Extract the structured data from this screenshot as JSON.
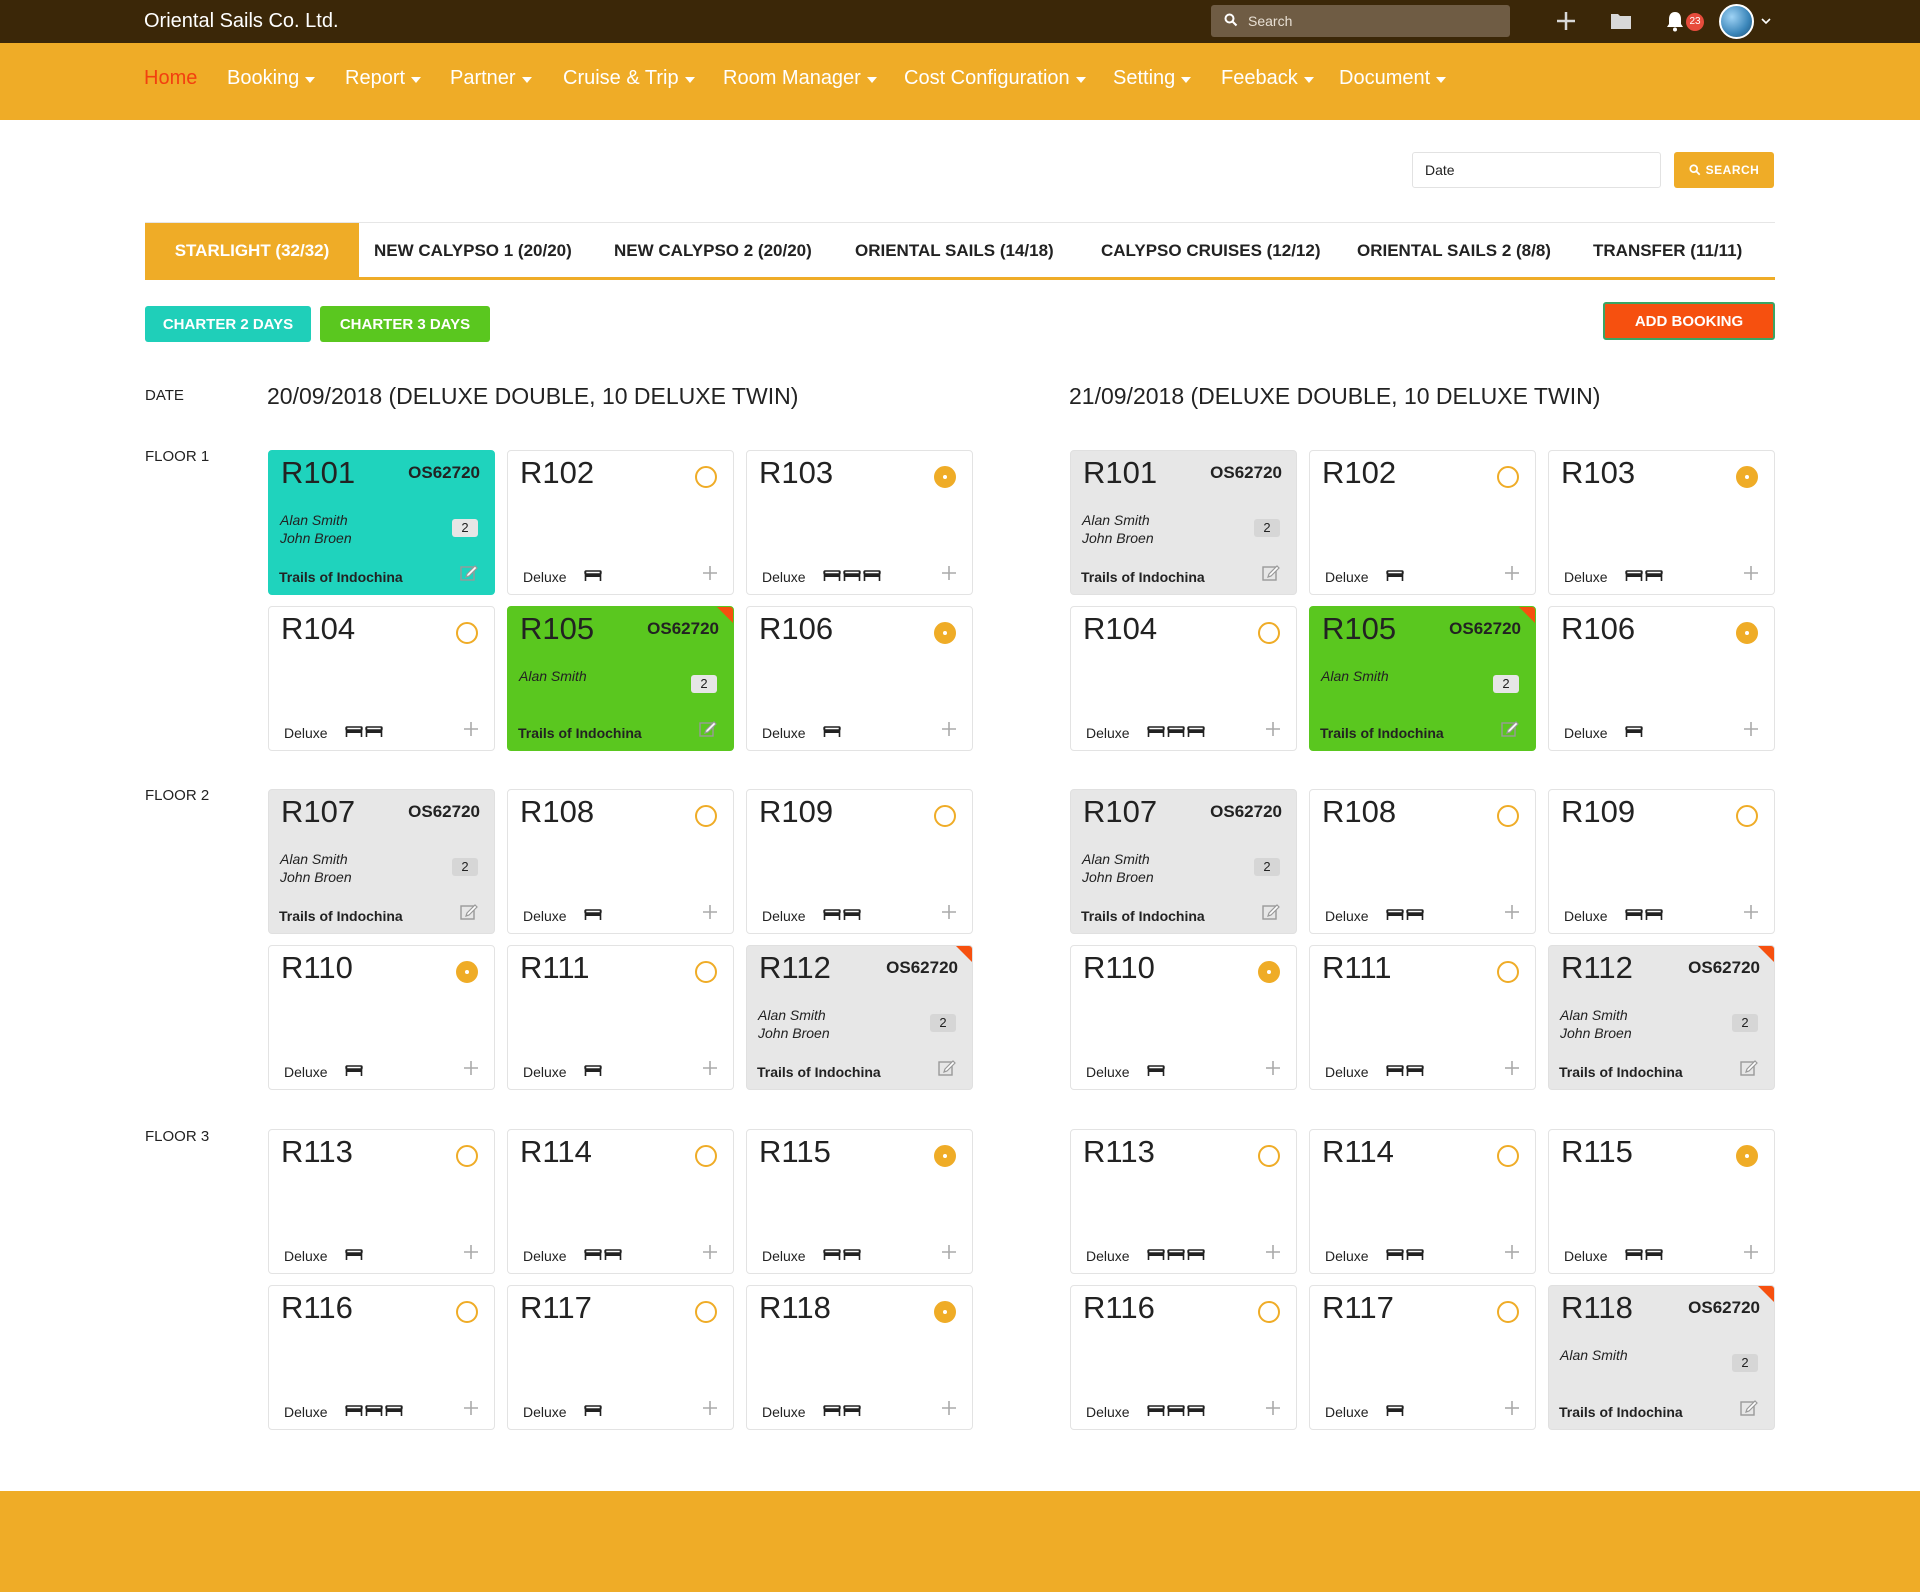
{
  "app": {
    "brand": "Oriental Sails Co. Ltd."
  },
  "topbar": {
    "search_placeholder": "Search",
    "notification_count": "23"
  },
  "nav": {
    "items": [
      {
        "label": "Home"
      },
      {
        "label": "Booking"
      },
      {
        "label": "Report"
      },
      {
        "label": "Partner"
      },
      {
        "label": "Cruise & Trip"
      },
      {
        "label": "Room Manager"
      },
      {
        "label": "Cost Configuration"
      },
      {
        "label": "Setting"
      },
      {
        "label": "Feeback"
      },
      {
        "label": "Document"
      }
    ]
  },
  "filter": {
    "date_placeholder": "Date",
    "search_label": "SEARCH"
  },
  "tabs": [
    {
      "label": "STARLIGHT (32/32)"
    },
    {
      "label": "NEW CALYPSO 1 (20/20)"
    },
    {
      "label": "NEW CALYPSO 2 (20/20)"
    },
    {
      "label": "ORIENTAL SAILS (14/18)"
    },
    {
      "label": "CALYPSO CRUISES (12/12)"
    },
    {
      "label": "ORIENTAL SAILS 2 (8/8)"
    },
    {
      "label": "TRANSFER (11/11)"
    }
  ],
  "buttons": {
    "charter2": "CHARTER 2 DAYS",
    "charter3": "CHARTER 3 DAYS",
    "add_booking": "ADD BOOKING"
  },
  "labels": {
    "date": "DATE",
    "floor1": "FLOOR 1",
    "floor2": "FLOOR 2",
    "floor3": "FLOOR 3"
  },
  "days": [
    {
      "heading": "20/09/2018 (DELUXE DOUBLE, 10 DELUXE TWIN)",
      "rooms": [
        {
          "num": "R101",
          "booked": true,
          "color": "teal",
          "code": "OS62720",
          "guests": [
            "Alan Smith",
            "John Broen"
          ],
          "pax": "2",
          "trip": "Trails of Indochina",
          "flag": false
        },
        {
          "num": "R102",
          "booked": false,
          "selected": false,
          "type": "Deluxe",
          "beds": 1
        },
        {
          "num": "R103",
          "booked": false,
          "selected": true,
          "type": "Deluxe",
          "beds": 3
        },
        {
          "num": "R104",
          "booked": false,
          "selected": false,
          "type": "Deluxe",
          "beds": 2
        },
        {
          "num": "R105",
          "booked": true,
          "color": "green",
          "code": "OS62720",
          "guests": [
            "Alan Smith"
          ],
          "pax": "2",
          "trip": "Trails of Indochina",
          "flag": true
        },
        {
          "num": "R106",
          "booked": false,
          "selected": true,
          "type": "Deluxe",
          "beds": 1
        },
        {
          "num": "R107",
          "booked": true,
          "color": "grey",
          "code": "OS62720",
          "guests": [
            "Alan Smith",
            "John Broen"
          ],
          "pax": "2",
          "trip": "Trails of Indochina",
          "flag": false
        },
        {
          "num": "R108",
          "booked": false,
          "selected": false,
          "type": "Deluxe",
          "beds": 1
        },
        {
          "num": "R109",
          "booked": false,
          "selected": false,
          "type": "Deluxe",
          "beds": 2
        },
        {
          "num": "R110",
          "booked": false,
          "selected": true,
          "type": "Deluxe",
          "beds": 1
        },
        {
          "num": "R111",
          "booked": false,
          "selected": false,
          "type": "Deluxe",
          "beds": 1
        },
        {
          "num": "R112",
          "booked": true,
          "color": "grey",
          "code": "OS62720",
          "guests": [
            "Alan Smith",
            "John Broen"
          ],
          "pax": "2",
          "trip": "Trails of Indochina",
          "flag": true
        },
        {
          "num": "R113",
          "booked": false,
          "selected": false,
          "type": "Deluxe",
          "beds": 1
        },
        {
          "num": "R114",
          "booked": false,
          "selected": false,
          "type": "Deluxe",
          "beds": 2
        },
        {
          "num": "R115",
          "booked": false,
          "selected": true,
          "type": "Deluxe",
          "beds": 2
        },
        {
          "num": "R116",
          "booked": false,
          "selected": false,
          "type": "Deluxe",
          "beds": 3
        },
        {
          "num": "R117",
          "booked": false,
          "selected": false,
          "type": "Deluxe",
          "beds": 1
        },
        {
          "num": "R118",
          "booked": false,
          "selected": true,
          "type": "Deluxe",
          "beds": 2
        }
      ]
    },
    {
      "heading": "21/09/2018 (DELUXE DOUBLE, 10 DELUXE TWIN)",
      "rooms": [
        {
          "num": "R101",
          "booked": true,
          "color": "grey",
          "code": "OS62720",
          "guests": [
            "Alan Smith",
            "John Broen"
          ],
          "pax": "2",
          "trip": "Trails of Indochina",
          "flag": false
        },
        {
          "num": "R102",
          "booked": false,
          "selected": false,
          "type": "Deluxe",
          "beds": 1
        },
        {
          "num": "R103",
          "booked": false,
          "selected": true,
          "type": "Deluxe",
          "beds": 2
        },
        {
          "num": "R104",
          "booked": false,
          "selected": false,
          "type": "Deluxe",
          "beds": 3
        },
        {
          "num": "R105",
          "booked": true,
          "color": "green",
          "code": "OS62720",
          "guests": [
            "Alan Smith"
          ],
          "pax": "2",
          "trip": "Trails of Indochina",
          "flag": true
        },
        {
          "num": "R106",
          "booked": false,
          "selected": true,
          "type": "Deluxe",
          "beds": 1
        },
        {
          "num": "R107",
          "booked": true,
          "color": "grey",
          "code": "OS62720",
          "guests": [
            "Alan Smith",
            "John Broen"
          ],
          "pax": "2",
          "trip": "Trails of Indochina",
          "flag": false
        },
        {
          "num": "R108",
          "booked": false,
          "selected": false,
          "type": "Deluxe",
          "beds": 2
        },
        {
          "num": "R109",
          "booked": false,
          "selected": false,
          "type": "Deluxe",
          "beds": 2
        },
        {
          "num": "R110",
          "booked": false,
          "selected": true,
          "type": "Deluxe",
          "beds": 1
        },
        {
          "num": "R111",
          "booked": false,
          "selected": false,
          "type": "Deluxe",
          "beds": 2
        },
        {
          "num": "R112",
          "booked": true,
          "color": "grey",
          "code": "OS62720",
          "guests": [
            "Alan Smith",
            "John Broen"
          ],
          "pax": "2",
          "trip": "Trails of Indochina",
          "flag": true
        },
        {
          "num": "R113",
          "booked": false,
          "selected": false,
          "type": "Deluxe",
          "beds": 3
        },
        {
          "num": "R114",
          "booked": false,
          "selected": false,
          "type": "Deluxe",
          "beds": 2
        },
        {
          "num": "R115",
          "booked": false,
          "selected": true,
          "type": "Deluxe",
          "beds": 2
        },
        {
          "num": "R116",
          "booked": false,
          "selected": false,
          "type": "Deluxe",
          "beds": 3
        },
        {
          "num": "R117",
          "booked": false,
          "selected": false,
          "type": "Deluxe",
          "beds": 1
        },
        {
          "num": "R118",
          "booked": true,
          "color": "grey",
          "code": "OS62720",
          "guests": [
            "Alan Smith"
          ],
          "pax": "2",
          "trip": "Trails of Indochina",
          "flag": true
        }
      ]
    }
  ],
  "colors": {
    "primary": "#efac27",
    "topbar": "#3b2708",
    "active_nav": "#f2400f",
    "teal": "#1fd3bd",
    "green": "#5ac71f",
    "booked_grey": "#e7e7e7",
    "danger": "#f6500f"
  }
}
